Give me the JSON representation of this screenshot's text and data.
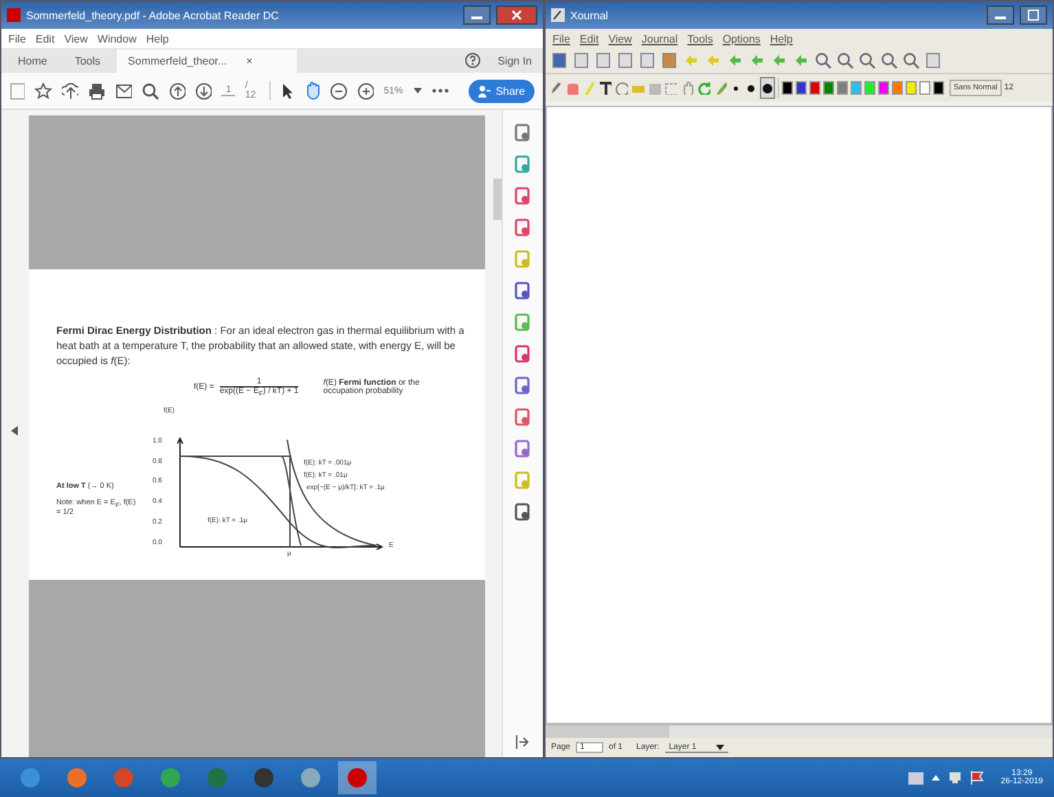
{
  "reader": {
    "title": "Sommerfeld_theory.pdf - Adobe Acrobat Reader DC",
    "menu": [
      "File",
      "Edit",
      "View",
      "Window",
      "Help"
    ],
    "tabs": [
      {
        "label": "Home",
        "selected": false
      },
      {
        "label": "Tools",
        "selected": false
      },
      {
        "label": "Sommerfeld_theor...",
        "selected": true
      }
    ],
    "tab_close": "×",
    "sign_in": "Sign In",
    "page_field": "1",
    "page_total": "/ 12",
    "zoom": "51%",
    "share": "Share",
    "document": {
      "paragraph": "**Fermi Dirac Energy Distribution** : For an ideal electron gas in thermal equilibrium with a heat bath at a temperature T, the probability that an allowed state, with energy E, will be occupied is *f*(E):",
      "formula_lhs": "f(E) =",
      "formula_numerator": "1",
      "formula_denominator": "exp((E − E$_{F}$) / kT) + 1",
      "formula_note": "*f*(E) **Fermi function** or the occupation probability",
      "side_heading": "**At low T** (→ 0 K)",
      "side_note": "Note: when E = E$_{F}$, f(E) = 1/2",
      "y_axis": "f(E)",
      "y_ticks": [
        "1.0",
        "0.8",
        "0.6",
        "0.4",
        "0.2",
        "0.0"
      ],
      "x_axis": "E",
      "x_mark": "μ",
      "curve_labels": [
        "f(E): kT = .001μ",
        "f(E): kT = .01μ",
        "exp[−(E − μ)/kT]: kT = .1μ",
        "f(E): kT = .1μ"
      ]
    }
  },
  "xournal": {
    "title": "Xournal",
    "menu": [
      "File",
      "Edit",
      "View",
      "Journal",
      "Tools",
      "Options",
      "Help"
    ],
    "pen_sizes": [
      {
        "selected": false
      },
      {
        "selected": false
      },
      {
        "selected": true
      }
    ],
    "colors": [
      {
        "color": "#000000"
      },
      {
        "color": "#3333cc"
      },
      {
        "color": "#dd0000"
      },
      {
        "color": "#008800"
      },
      {
        "color": "#808080"
      },
      {
        "color": "#33bbee"
      },
      {
        "color": "#22ee22"
      },
      {
        "color": "#ee00ee"
      },
      {
        "color": "#ff7700"
      },
      {
        "color": "#eeee00"
      },
      {
        "color": "#ffffff"
      },
      {
        "color": "#000000"
      }
    ],
    "font": "Sans Normal",
    "font_size": "12",
    "page_label": "Page",
    "page_field": "1",
    "page_total": "of 1",
    "layer_label": "Layer:",
    "layer": "Layer 1"
  },
  "taskbar": {
    "time": "13:29",
    "date": "26-12-2019"
  }
}
